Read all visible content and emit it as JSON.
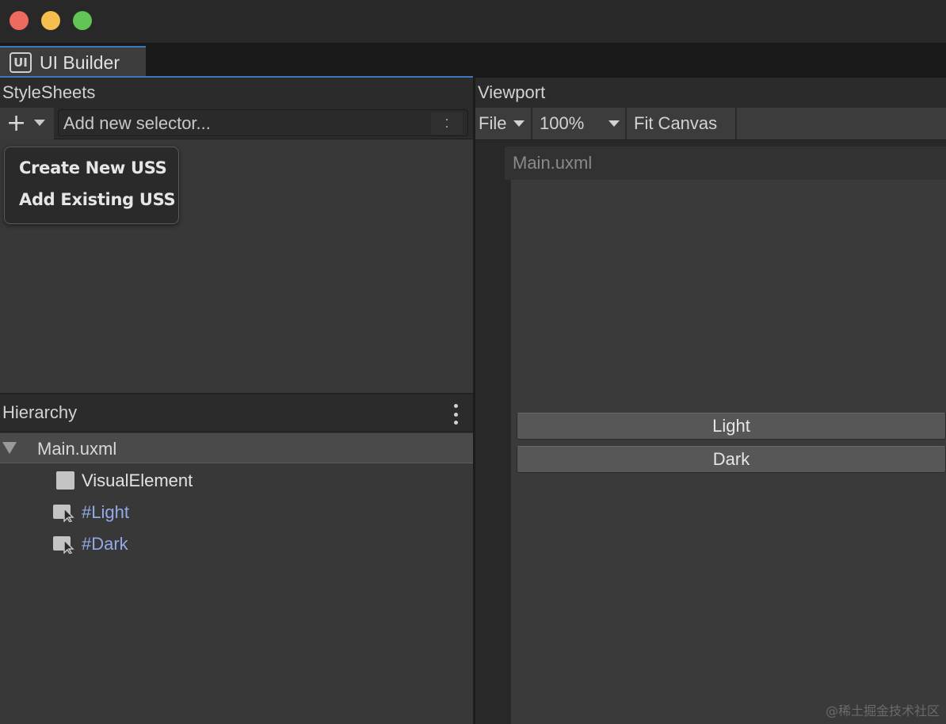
{
  "window": {
    "tab_title": "UI Builder",
    "tab_icon": "UI"
  },
  "stylesheets": {
    "title": "StyleSheets",
    "selector_placeholder": "Add new selector...",
    "selector_colon": ":",
    "add_menu": [
      {
        "label": "Create New USS"
      },
      {
        "label": "Add Existing USS"
      }
    ]
  },
  "hierarchy": {
    "title": "Hierarchy",
    "root": "Main.uxml",
    "items": [
      {
        "label": "VisualElement",
        "icon": "visual-element-icon"
      },
      {
        "label": "#Light",
        "icon": "button-element-icon"
      },
      {
        "label": "#Dark",
        "icon": "button-element-icon"
      }
    ]
  },
  "viewport": {
    "title": "Viewport",
    "file_menu": "File",
    "zoom": "100%",
    "fit_canvas": "Fit Canvas",
    "canvas_title": "Main.uxml",
    "buttons": [
      "Light",
      "Dark"
    ]
  },
  "watermark": "@稀土掘金技术社区",
  "colors": {
    "accent": "#3a79bb",
    "named_element": "#93aae8",
    "traffic_red": "#ee6a5e",
    "traffic_yellow": "#f5bf4f",
    "traffic_green": "#61c454"
  }
}
